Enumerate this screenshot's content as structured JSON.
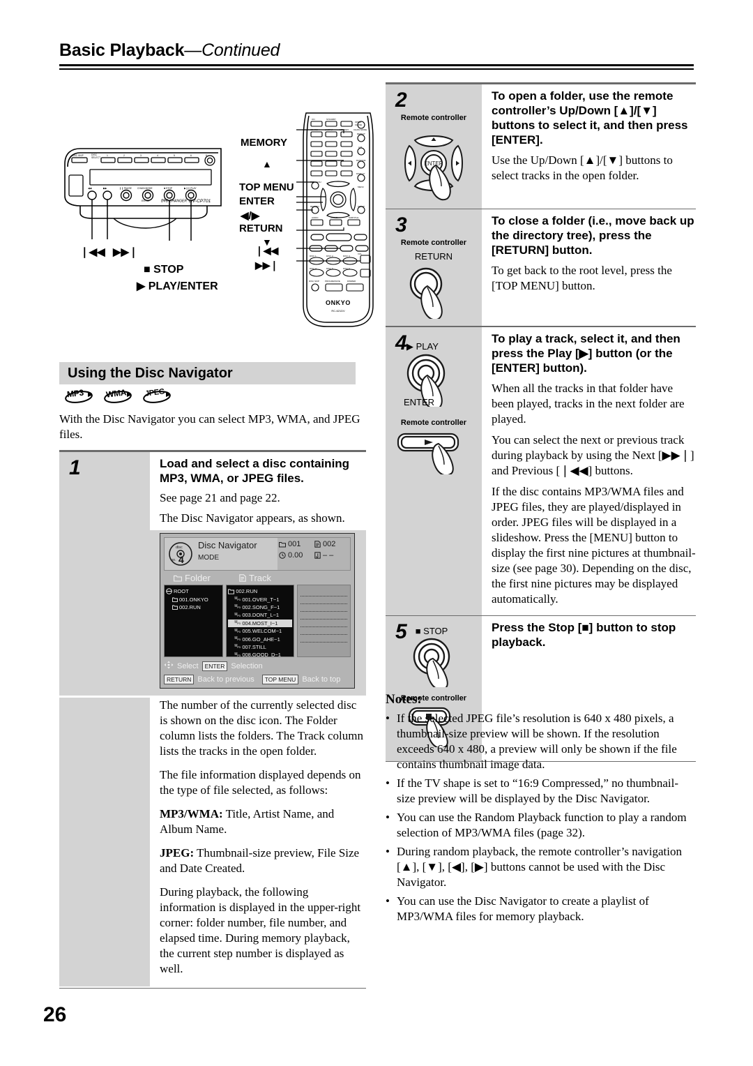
{
  "header": {
    "title_main": "Basic Playback",
    "title_cont": "—Continued"
  },
  "page_number": "26",
  "front_panel": {
    "model": "DV-CP701",
    "brand_line": "DVD CHANGER",
    "disc_skip_label": "DISC SKIP",
    "disc_select_label": "DISC SELECT",
    "button_labels": [
      "1",
      "2",
      "3",
      "4",
      "5",
      "6"
    ],
    "transport_labels": [
      "PAUSE",
      "CHAIN MODE",
      "STOP",
      "PLAY"
    ],
    "callouts": {
      "prev": "❘◀◀",
      "next": "▶▶❘",
      "stop": "■ STOP",
      "play_enter": "▶ PLAY/ENTER"
    }
  },
  "remote_diagram": {
    "brand": "ONKYO",
    "model": "RC-621DV",
    "callouts": {
      "memory": "MEMORY",
      "up": "▲",
      "top_menu": "TOP MENU",
      "enter": "ENTER",
      "left_right": "◀/▶",
      "return": "RETURN",
      "down": "▼",
      "prev": "❘◀◀",
      "next": "▶▶❘"
    },
    "row_labels": [
      "ON",
      "STANDBY",
      "OPEN/CLOSE",
      "SEARCH",
      "LAST M",
      "MEMORY",
      "CHAIN MODE",
      "REPEAT",
      "A-B",
      "RANDOM",
      "DISPLAY",
      "MENU",
      "SETUP",
      "AUDIO",
      "ANGLE",
      "SUBTITLE",
      "TOP MENU",
      "RETURN",
      "DISC 1",
      "DISC 2",
      "DISC 3",
      "DISC 4",
      "DISC 5",
      "DISC 6",
      "DISC SKIP",
      "PROGRESSIVE",
      "DIMMER",
      "VOL"
    ]
  },
  "section": {
    "heading": "Using the Disc Navigator",
    "badges": [
      "MP3",
      "WMA",
      "JPEG"
    ],
    "intro": "With the Disc Navigator you can select MP3, WMA, and JPEG files."
  },
  "left_steps": [
    {
      "num": "1",
      "head": "Load and select a disc containing MP3, WMA, or JPEG files.",
      "paras": [
        "See page 21 and page 22.",
        "The Disc Navigator appears, as shown."
      ]
    }
  ],
  "disc_navigator": {
    "title": "Disc Navigator",
    "mode_label": "MODE",
    "disc_icon_text": {
      "top": "disc",
      "bottom": "no.",
      "number": "4"
    },
    "status": {
      "folder_icon": "folder-icon",
      "folder_value": "001",
      "file_icon": "file-icon",
      "file_value": "002",
      "time_icon": "clock-icon",
      "time_value": "0.00",
      "step_icon": "memory-step-icon",
      "step_value": "– –"
    },
    "columns": {
      "folder": "Folder",
      "track": "Track"
    },
    "folder_items": [
      {
        "label": "ROOT",
        "icon": "root-icon",
        "indent": 0,
        "selected": false
      },
      {
        "label": "001.ONKYO",
        "icon": "folder-icon",
        "indent": 1,
        "selected": false
      },
      {
        "label": "002.RUN",
        "icon": "folder-icon",
        "indent": 1,
        "selected": false
      }
    ],
    "track_items": [
      {
        "label": "002.RUN",
        "icon": "folder-open-icon",
        "indent": 0,
        "selected": false
      },
      {
        "label": "001.OVER_T~1",
        "icon": "mp3-icon",
        "indent": 1,
        "selected": false
      },
      {
        "label": "002.SONG_F~1",
        "icon": "mp3-icon",
        "indent": 1,
        "selected": false
      },
      {
        "label": "003.DONT_L~1",
        "icon": "mp3-icon",
        "indent": 1,
        "selected": false
      },
      {
        "label": "004.MOST_I~1",
        "icon": "mp3-icon",
        "indent": 1,
        "selected": true
      },
      {
        "label": "005.WELCOM~1",
        "icon": "mp3-icon",
        "indent": 1,
        "selected": false
      },
      {
        "label": "006.GO_AHE~1",
        "icon": "mp3-icon",
        "indent": 1,
        "selected": false
      },
      {
        "label": "007.STILL",
        "icon": "mp3-icon",
        "indent": 1,
        "selected": false
      },
      {
        "label": "008.GOOD_D~1",
        "icon": "mp3-icon",
        "indent": 1,
        "selected": false
      }
    ],
    "legend": [
      {
        "key": "",
        "key_icon": "dpad-icon",
        "text": "Select"
      },
      {
        "key": "ENTER",
        "text": "Selection"
      },
      {
        "key": "RETURN",
        "text": "Back to previous"
      },
      {
        "key": "TOP MENU",
        "text": "Back to top"
      }
    ]
  },
  "left_tail_paragraphs": [
    "The number of the currently selected disc is shown on the disc icon. The Folder column lists the folders. The Track column lists the tracks in the open folder.",
    "The file information displayed depends on the type of file selected, as follows:"
  ],
  "left_defs": [
    {
      "term": "MP3/WMA:",
      "def": " Title, Artist Name, and Album Name."
    },
    {
      "term": "JPEG:",
      "def": " Thumbnail-size preview, File Size and Date Created."
    }
  ],
  "left_last_paragraph": "During playback, the following information is displayed in the upper-right corner: folder number, file number, and elapsed time. During memory playback, the current step number is displayed as well.",
  "right_steps": [
    {
      "num": "2",
      "device_label": "Remote controller",
      "art": "dpad-enter",
      "head": "To open a folder, use the remote controller’s Up/Down [▲]/[▼] buttons to select it, and then press [ENTER].",
      "paras": [
        "Use the Up/Down [▲]/[▼] buttons to select tracks in the open folder."
      ]
    },
    {
      "num": "3",
      "device_label": "Remote controller",
      "art": "return-button",
      "art_label": "RETURN",
      "head": "To close a folder (i.e., move back up the directory tree), press the [RETURN] button.",
      "paras": [
        "To get back to the root level, press the [TOP MENU] button."
      ]
    },
    {
      "num": "4",
      "device_label": "Remote controller",
      "art": "play-knob",
      "art_label_top": "▶ PLAY",
      "art_label_bottom": "ENTER",
      "head": "To play a track, select it, and then press the Play [▶] button (or the [ENTER] button).",
      "paras": [
        "When all the tracks in that folder have been played, tracks in the next folder are played.",
        "You can select the next or previous track during playback by using the Next [▶▶❘] and Previous [❘◀◀] buttons.",
        "If the disc contains MP3/WMA files and JPEG files, they are played/displayed in order. JPEG files will be displayed in a slideshow. Press the [MENU] button to display the first nine pictures at thumbnail-size (see page 30). Depending on the disc, the first nine pictures may be displayed automatically."
      ]
    },
    {
      "num": "5",
      "device_label": "Remote controller",
      "art": "stop-knob",
      "art_label_top": "■ STOP",
      "head": "Press the Stop [■] button to stop playback.",
      "paras": []
    }
  ],
  "notes": {
    "heading": "Notes:",
    "items": [
      "If the selected JPEG file’s resolution is 640 x 480 pixels, a thumbnail-size preview will be shown. If the resolution exceeds 640 x 480, a preview will only be shown if the file contains thumbnail image data.",
      "If the TV shape is set to “16:9 Compressed,” no thumbnail-size preview will be displayed by the Disc Navigator.",
      "You can use the Random Playback function to play a random selection of MP3/WMA files (page 32).",
      "During random playback, the remote controller’s navigation [▲], [▼], [◀], [▶] buttons cannot be used with the Disc Navigator.",
      "You can use the Disc Navigator to create a playlist of MP3/WMA files for memory playback."
    ]
  },
  "colors": {
    "gray_panel": "#d3d3d3",
    "rule": "#6b6b6b",
    "screen_bg": "#b4b4b4",
    "list_bg": "#0b0b0b"
  }
}
